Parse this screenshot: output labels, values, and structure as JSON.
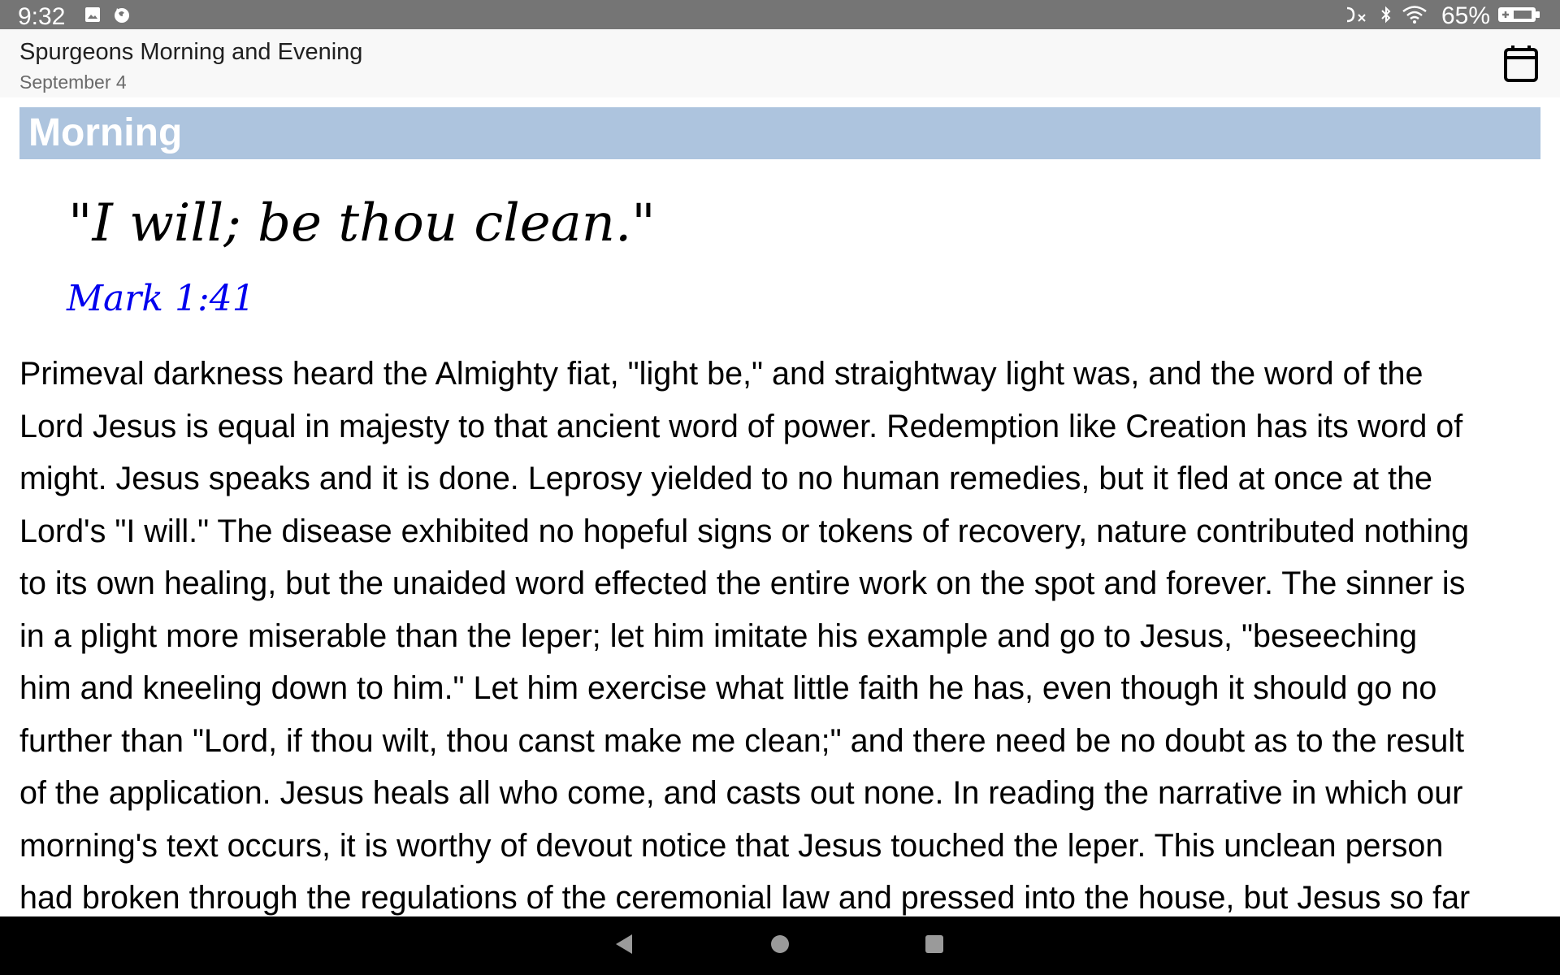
{
  "status_bar": {
    "time": "9:32",
    "left_icons": [
      "image-notification-icon",
      "firefox-icon"
    ],
    "right_icons": [
      "no-signal-icon",
      "bluetooth-icon",
      "wifi-icon"
    ],
    "battery_percent": "65%",
    "battery_icon": "battery-charging-icon"
  },
  "header": {
    "title": "Spurgeons Morning and Evening",
    "subtitle": "September 4",
    "calendar_icon": "calendar-icon"
  },
  "section": {
    "title": "Morning",
    "bar_color": "#adc4de"
  },
  "verse": {
    "quote": "\"I will; be thou clean.\"",
    "reference": "Mark 1:41",
    "reference_color": "#0000ee"
  },
  "body": {
    "lines": [
      "Primeval darkness heard the Almighty fiat, \"light be,\" and straightway light was, and the word of the",
      "Lord Jesus is equal in majesty to that ancient word of power. Redemption like Creation has its word of",
      "might. Jesus speaks and it is done. Leprosy yielded to no human remedies, but it fled at once at the",
      "Lord's \"I will.\" The disease exhibited no hopeful signs or tokens of recovery, nature contributed nothing",
      "to its own healing, but the unaided word effected the entire work on the spot and forever. The sinner is",
      "in a plight more miserable than the leper; let him imitate his example and go to Jesus, \"beseeching",
      "him and kneeling down to him.\" Let him exercise what little faith he has, even though it should go no",
      "further than \"Lord, if thou wilt, thou canst make me clean;\" and there need be no doubt as to the result",
      "of the application. Jesus heals all who come, and casts out none. In reading the narrative in which our",
      "morning's text occurs, it is worthy of devout notice that Jesus touched the leper. This unclean person",
      "had broken through the regulations of the ceremonial law and pressed into the house, but Jesus so far"
    ]
  },
  "nav_bar": {
    "buttons": [
      "back-icon",
      "home-icon",
      "recents-icon"
    ]
  }
}
